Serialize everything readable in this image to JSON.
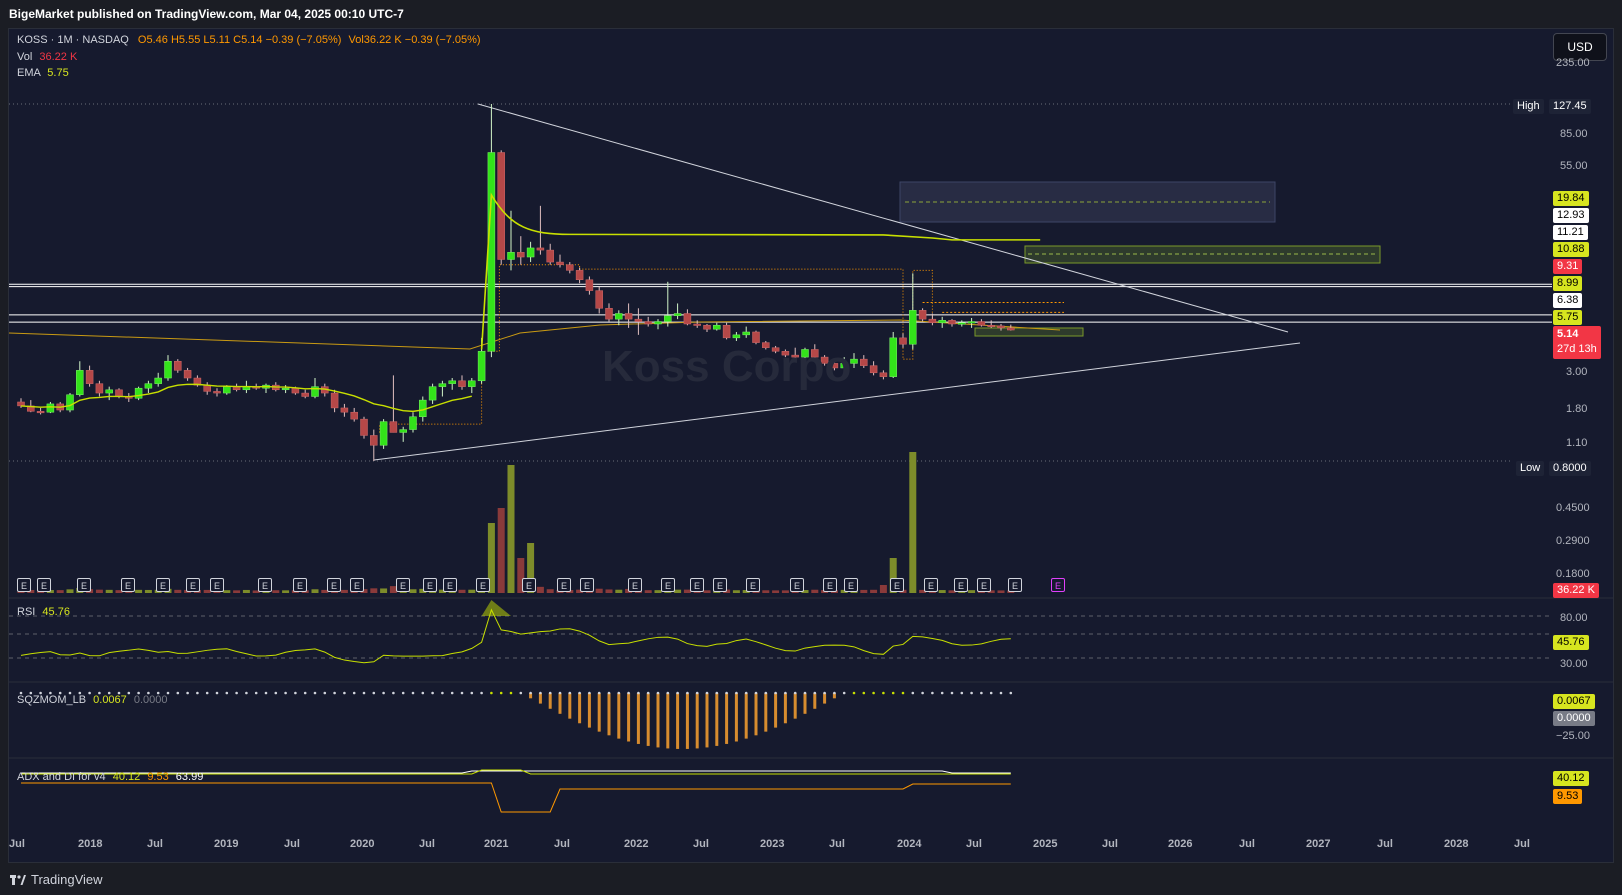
{
  "header": {
    "published": "BigeMarket published on TradingView.com, Mar 04, 2025 00:10 UTC-7"
  },
  "symbol": {
    "title": "KOSS · 1M · NASDAQ",
    "open": "O5.46",
    "high": "H5.55",
    "low": "L5.11",
    "close": "C5.14",
    "change": "−0.39 (−7.05%)",
    "vol": "Vol36.22 K",
    "vol_change": "−0.39 (−7.05%)"
  },
  "legend": {
    "vol_label": "Vol",
    "vol_value": "36.22 K",
    "ema_label": "EMA",
    "ema_value": "5.75",
    "rsi_label": "RSI",
    "rsi_value": "45.76",
    "sqz_label": "SQZMOM_LB",
    "sqz_value1": "0.0067",
    "sqz_value2": "0.0000",
    "adx_label": "ADX and DI for v4",
    "adx_v1": "40.12",
    "adx_v2": "9.53",
    "adx_v3": "63.99"
  },
  "watermark": "Koss Corpo",
  "currency_button": "USD",
  "price_axis": {
    "ticks": [
      "235.00",
      "85.00",
      "55.00",
      "3.00",
      "1.80",
      "1.10",
      "0.4500",
      "0.2900",
      "0.1800"
    ],
    "high_label": "High",
    "high_value": "127.45",
    "low_label": "Low",
    "low_value": "0.8000",
    "levels": [
      "19.84",
      "12.93",
      "11.21",
      "10.88",
      "9.31",
      "8.99",
      "6.38",
      "5.75"
    ],
    "last_price": "5.14",
    "countdown": "27d 13h",
    "volume_label": "36.22 K"
  },
  "rsi_axis": {
    "ticks": [
      "80.00",
      "30.00"
    ],
    "value": "45.76"
  },
  "sqz_axis": {
    "ticks": [
      "−25.00"
    ],
    "value1": "0.0067",
    "value2": "0.0000"
  },
  "adx_axis": {
    "value1": "40.12",
    "value2": "9.53"
  },
  "time_axis": [
    "Jul",
    "2018",
    "Jul",
    "2019",
    "Jul",
    "2020",
    "Jul",
    "2021",
    "Jul",
    "2022",
    "Jul",
    "2023",
    "Jul",
    "2024",
    "Jul",
    "2025",
    "Jul",
    "2026",
    "Jul",
    "2027",
    "Jul",
    "2028",
    "Jul"
  ],
  "earnings_badge": "E",
  "brand": "TradingView",
  "colors": {
    "bull": "#33e31a",
    "bear": "#b54848",
    "ema": "#c8e000",
    "bg": "#161a2e",
    "last_price": "#f23645"
  },
  "chart_data": {
    "type": "candlestick",
    "interval": "1M",
    "scale": "log",
    "ylim": [
      0.8,
      235
    ],
    "x_start": "2017-06",
    "x_end": "2025-03",
    "candles": [
      [
        1.85,
        1.95,
        1.7,
        1.75
      ],
      [
        1.75,
        1.9,
        1.6,
        1.62
      ],
      [
        1.62,
        1.7,
        1.55,
        1.6
      ],
      [
        1.6,
        1.85,
        1.58,
        1.8
      ],
      [
        1.8,
        1.85,
        1.6,
        1.65
      ],
      [
        1.65,
        2.1,
        1.6,
        2.05
      ],
      [
        2.05,
        3.3,
        2.0,
        2.9
      ],
      [
        2.9,
        3.1,
        2.3,
        2.4
      ],
      [
        2.4,
        2.5,
        2.0,
        2.1
      ],
      [
        2.1,
        2.3,
        1.9,
        2.2
      ],
      [
        2.2,
        2.25,
        1.95,
        2.0
      ],
      [
        2.0,
        2.1,
        1.85,
        1.95
      ],
      [
        1.95,
        2.3,
        1.9,
        2.25
      ],
      [
        2.25,
        2.5,
        2.1,
        2.4
      ],
      [
        2.4,
        2.8,
        2.3,
        2.6
      ],
      [
        2.6,
        3.6,
        2.5,
        3.3
      ],
      [
        3.3,
        3.4,
        2.8,
        2.9
      ],
      [
        2.9,
        3.0,
        2.5,
        2.6
      ],
      [
        2.6,
        2.7,
        2.3,
        2.35
      ],
      [
        2.35,
        2.45,
        2.05,
        2.15
      ],
      [
        2.15,
        2.25,
        2.0,
        2.1
      ],
      [
        2.1,
        2.35,
        2.05,
        2.3
      ],
      [
        2.3,
        2.4,
        2.15,
        2.2
      ],
      [
        2.2,
        2.5,
        2.1,
        2.3
      ],
      [
        2.3,
        2.4,
        2.2,
        2.25
      ],
      [
        2.25,
        2.4,
        2.1,
        2.35
      ],
      [
        2.35,
        2.45,
        2.15,
        2.2
      ],
      [
        2.2,
        2.35,
        2.1,
        2.25
      ],
      [
        2.25,
        2.3,
        2.05,
        2.1
      ],
      [
        2.1,
        2.2,
        1.95,
        2.0
      ],
      [
        2.0,
        2.6,
        1.95,
        2.3
      ],
      [
        2.3,
        2.4,
        2.0,
        2.1
      ],
      [
        2.1,
        2.2,
        1.6,
        1.7
      ],
      [
        1.7,
        1.8,
        1.5,
        1.6
      ],
      [
        1.6,
        1.7,
        1.4,
        1.45
      ],
      [
        1.45,
        1.5,
        1.1,
        1.15
      ],
      [
        1.15,
        1.25,
        0.8,
        1.0
      ],
      [
        1.0,
        1.45,
        0.95,
        1.4
      ],
      [
        1.4,
        2.7,
        1.2,
        1.2
      ],
      [
        1.2,
        1.3,
        1.05,
        1.25
      ],
      [
        1.25,
        1.6,
        1.2,
        1.5
      ],
      [
        1.5,
        2.0,
        1.4,
        1.9
      ],
      [
        1.9,
        2.4,
        1.8,
        2.3
      ],
      [
        2.3,
        2.5,
        2.0,
        2.4
      ],
      [
        2.4,
        2.6,
        2.2,
        2.5
      ],
      [
        2.5,
        2.7,
        2.2,
        2.3
      ],
      [
        2.3,
        2.6,
        2.1,
        2.5
      ],
      [
        2.5,
        4.6,
        2.4,
        3.8
      ],
      [
        3.8,
        127.45,
        3.5,
        64.0
      ],
      [
        64.0,
        66.0,
        13.0,
        14.0
      ],
      [
        14.0,
        28.0,
        12.0,
        15.5
      ],
      [
        15.5,
        19.5,
        13.0,
        14.5
      ],
      [
        14.5,
        18.0,
        13.5,
        16.5
      ],
      [
        16.5,
        30.0,
        15.0,
        16.0
      ],
      [
        16.0,
        17.5,
        13.0,
        13.5
      ],
      [
        13.5,
        15.0,
        12.5,
        13.0
      ],
      [
        13.0,
        13.5,
        11.5,
        12.0
      ],
      [
        12.0,
        12.5,
        10.0,
        10.5
      ],
      [
        10.5,
        11.0,
        8.5,
        9.0
      ],
      [
        9.0,
        9.5,
        6.5,
        7.0
      ],
      [
        7.0,
        7.5,
        5.8,
        6.0
      ],
      [
        6.0,
        6.8,
        5.5,
        6.5
      ],
      [
        6.5,
        7.5,
        5.3,
        6.0
      ],
      [
        6.0,
        7.0,
        4.8,
        5.8
      ],
      [
        5.8,
        6.2,
        5.4,
        5.6
      ],
      [
        5.6,
        6.0,
        5.2,
        5.8
      ],
      [
        5.8,
        10.2,
        5.4,
        6.3
      ],
      [
        6.3,
        7.5,
        6.0,
        6.5
      ],
      [
        6.5,
        6.9,
        5.5,
        5.6
      ],
      [
        5.6,
        5.9,
        5.3,
        5.5
      ],
      [
        5.5,
        5.6,
        5.0,
        5.2
      ],
      [
        5.2,
        5.7,
        5.1,
        5.5
      ],
      [
        5.5,
        5.7,
        4.5,
        4.6
      ],
      [
        4.6,
        5.0,
        4.4,
        4.8
      ],
      [
        4.8,
        5.4,
        4.6,
        5.0
      ],
      [
        5.0,
        5.1,
        4.2,
        4.3
      ],
      [
        4.3,
        4.4,
        3.9,
        4.0
      ],
      [
        4.0,
        4.1,
        3.7,
        3.8
      ],
      [
        3.8,
        3.9,
        3.5,
        3.6
      ],
      [
        3.6,
        4.0,
        3.4,
        3.5
      ],
      [
        3.5,
        4.0,
        3.4,
        3.9
      ],
      [
        3.9,
        4.2,
        3.4,
        3.5
      ],
      [
        3.5,
        3.6,
        3.1,
        3.2
      ],
      [
        3.2,
        3.3,
        2.9,
        3.0
      ],
      [
        3.0,
        3.5,
        2.9,
        3.2
      ],
      [
        3.2,
        3.7,
        3.0,
        3.4
      ],
      [
        3.4,
        3.6,
        3.0,
        3.1
      ],
      [
        3.1,
        3.3,
        2.7,
        2.8
      ],
      [
        2.8,
        2.9,
        2.55,
        2.65
      ],
      [
        2.65,
        5.0,
        2.6,
        4.6
      ],
      [
        4.6,
        4.9,
        4.0,
        4.2
      ],
      [
        4.2,
        11.5,
        3.9,
        6.8
      ],
      [
        6.8,
        7.0,
        5.8,
        6.0
      ],
      [
        6.0,
        6.5,
        5.5,
        5.7
      ],
      [
        5.7,
        6.2,
        5.3,
        5.9
      ],
      [
        5.9,
        6.0,
        5.4,
        5.6
      ],
      [
        5.6,
        5.9,
        5.4,
        5.7
      ],
      [
        5.7,
        6.1,
        5.3,
        5.8
      ],
      [
        5.8,
        6.0,
        5.4,
        5.5
      ],
      [
        5.5,
        5.9,
        5.3,
        5.45
      ],
      [
        5.45,
        5.6,
        5.1,
        5.3
      ],
      [
        5.3,
        5.55,
        5.1,
        5.14
      ]
    ],
    "volume_marker": {
      "label": "Vol",
      "last_value": "36.22 K"
    },
    "indicators": [
      {
        "name": "EMA",
        "last_value": 5.75
      },
      {
        "name": "RSI",
        "last_value": 45.76,
        "levels": [
          80,
          30
        ]
      },
      {
        "name": "SQZMOM_LB",
        "last_value": 0.0067
      },
      {
        "name": "ADX and DI for v4",
        "values": [
          40.12,
          9.53,
          63.99
        ]
      }
    ],
    "horizontal_levels": [
      9.31,
      8.99,
      6.38,
      5.75
    ],
    "all_time_high": 127.45,
    "all_time_low": 0.8
  }
}
